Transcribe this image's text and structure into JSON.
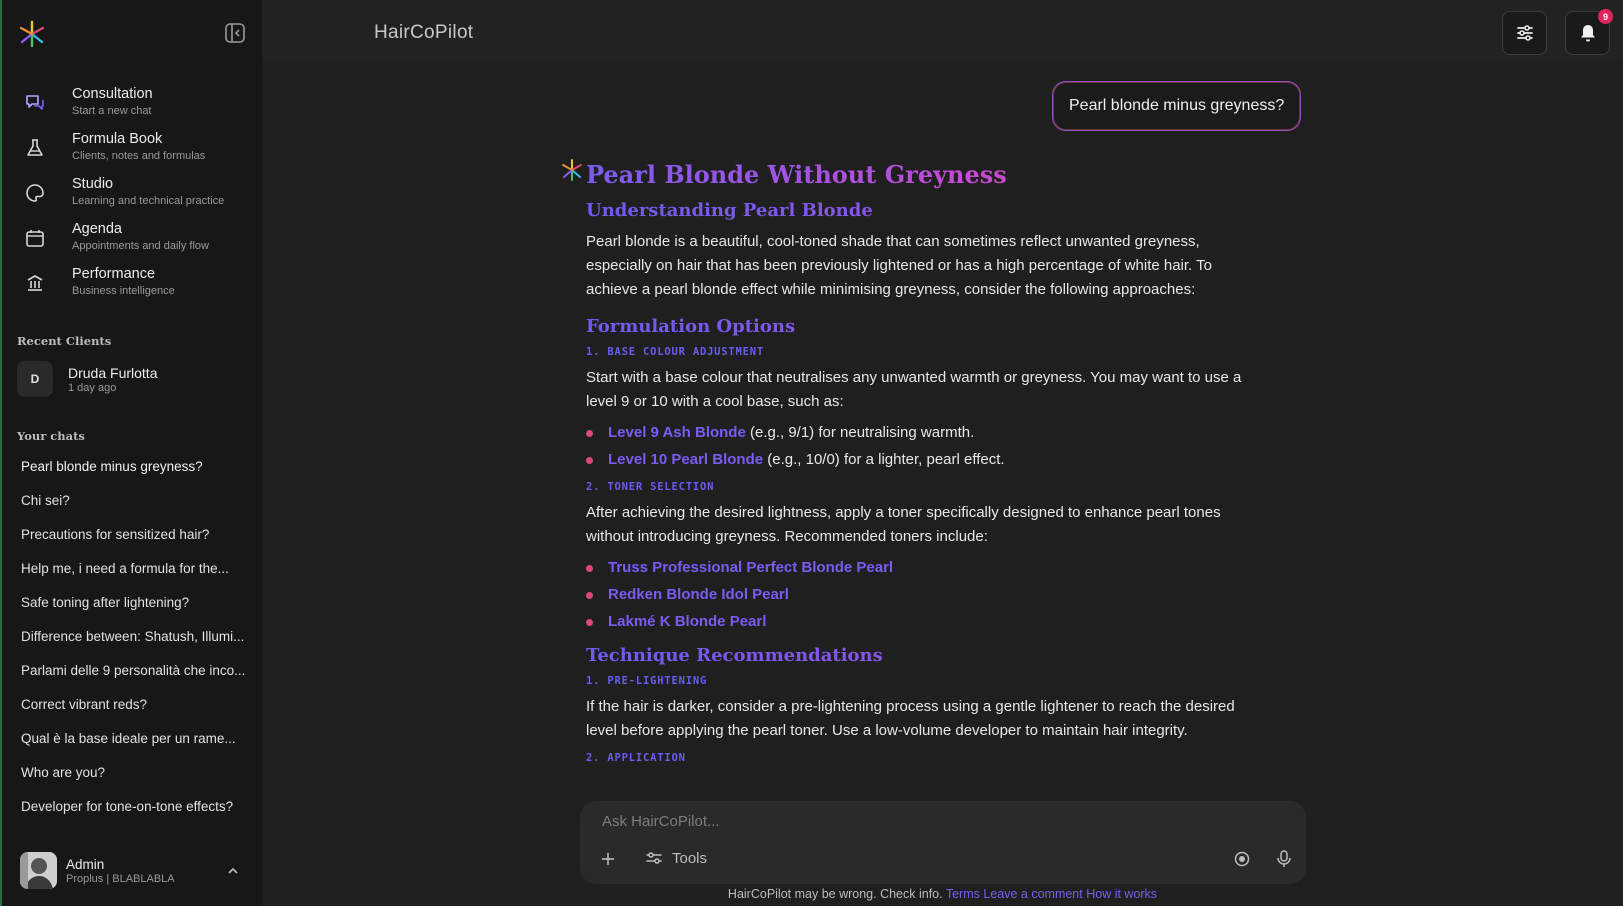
{
  "header": {
    "app_title": "HairCoPilot",
    "notification_count": "9"
  },
  "sidebar": {
    "nav": [
      {
        "title": "Consultation",
        "subtitle": "Start a new chat",
        "icon": "chat-bubbles-icon"
      },
      {
        "title": "Formula Book",
        "subtitle": "Clients, notes and formulas",
        "icon": "flask-icon"
      },
      {
        "title": "Studio",
        "subtitle": "Learning and technical practice",
        "icon": "palette-icon"
      },
      {
        "title": "Agenda",
        "subtitle": "Appointments and daily flow",
        "icon": "calendar-icon"
      },
      {
        "title": "Performance",
        "subtitle": "Business intelligence",
        "icon": "bank-icon"
      }
    ],
    "recent_clients_label": "Recent Clients",
    "recent_clients": [
      {
        "initial": "D",
        "name": "Druda Furlotta",
        "time": "1 day ago"
      }
    ],
    "your_chats_label": "Your chats",
    "chats": [
      "Pearl blonde minus greyness?",
      "Chi sei?",
      "Precautions for sensitized hair?",
      "Help me, i need a formula for the...",
      "Safe toning after lightening?",
      "Difference between: Shatush, Illumi...",
      "Parlami delle 9 personalità che inco...",
      "Correct vibrant reds?",
      "Qual è la base ideale per un rame...",
      "Who are you?",
      "Developer for tone-on-tone effects?"
    ],
    "user": {
      "name": "Admin",
      "plan": "Proplus | BLABLABLA"
    }
  },
  "conversation": {
    "user_message": "Pearl blonde minus greyness?",
    "answer": {
      "title": "Pearl Blonde Without Greyness",
      "understanding_heading": "Understanding Pearl Blonde",
      "understanding_text": "Pearl blonde is a beautiful, cool-toned shade that can sometimes reflect unwanted greyness, especially on hair that has been previously lightened or has a high percentage of white hair. To achieve a pearl blonde effect while minimising greyness, consider the following approaches:",
      "formulation_heading": "Formulation Options",
      "base_heading": "1. BASE COLOUR ADJUSTMENT",
      "base_text": "Start with a base colour that neutralises any unwanted warmth or greyness. You may want to use a level 9 or 10 with a cool base, such as:",
      "base_items": [
        {
          "strong": "Level 9 Ash Blonde",
          "rest": " (e.g., 9/1) for neutralising warmth."
        },
        {
          "strong": "Level 10 Pearl Blonde",
          "rest": " (e.g., 10/0) for a lighter, pearl effect."
        }
      ],
      "toner_heading": "2. TONER SELECTION",
      "toner_text": "After achieving the desired lightness, apply a toner specifically designed to enhance pearl tones without introducing greyness. Recommended toners include:",
      "toner_items": [
        "Truss Professional Perfect Blonde Pearl",
        "Redken Blonde Idol Pearl",
        "Lakmé K Blonde Pearl"
      ],
      "technique_heading": "Technique Recommendations",
      "prelight_heading": "1. PRE-LIGHTENING",
      "prelight_text": "If the hair is darker, consider a pre-lightening process using a gentle lightener to reach the desired level before applying the pearl toner. Use a low-volume developer to maintain hair integrity.",
      "application_heading": "2. APPLICATION"
    }
  },
  "composer": {
    "placeholder": "Ask HairCoPilot...",
    "tools_label": "Tools"
  },
  "footer": {
    "disclaimer": "HairCoPilot may be wrong. Check info.",
    "links": [
      "Terms",
      "Leave a comment",
      "How it works"
    ]
  },
  "colors": {
    "accent_purple": "#7a5cf5",
    "accent_pink": "#e0457a",
    "badge_red": "#e0245e"
  }
}
